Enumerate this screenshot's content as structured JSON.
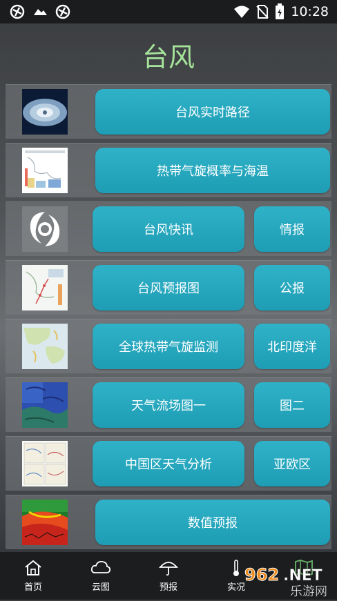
{
  "status_bar": {
    "time": "10:28",
    "icons_left": [
      "sync-icon",
      "cloud-icon",
      "sync-icon"
    ],
    "icons_right": [
      "wifi-icon",
      "no-sim-icon",
      "battery-icon"
    ]
  },
  "page_title": "台风",
  "rows": [
    {
      "thumb": "satellite-typhoon-thumbnail",
      "main_label": "台风实时路径",
      "side_label": null
    },
    {
      "thumb": "tropical-cyclone-map-thumbnail",
      "main_label": "热带气旋概率与海温",
      "side_label": null
    },
    {
      "thumb": "typhoon-symbol-thumbnail",
      "main_label": "台风快讯",
      "side_label": "情报"
    },
    {
      "thumb": "forecast-chart-thumbnail",
      "main_label": "台风预报图",
      "side_label": "公报"
    },
    {
      "thumb": "global-map-thumbnail",
      "main_label": "全球热带气旋监测",
      "side_label": "北印度洋"
    },
    {
      "thumb": "wind-field-thumbnail",
      "main_label": "天气流场图一",
      "side_label": "图二"
    },
    {
      "thumb": "weather-analysis-thumbnail",
      "main_label": "中国区天气分析",
      "side_label": "亚欧区"
    },
    {
      "thumb": "numeric-forecast-thumbnail",
      "main_label": "数值预报",
      "side_label": null
    }
  ],
  "bottom_nav": [
    {
      "label": "首页",
      "icon": "home-icon"
    },
    {
      "label": "云图",
      "icon": "cloud-icon"
    },
    {
      "label": "预报",
      "icon": "umbrella-icon"
    },
    {
      "label": "实况",
      "icon": "thermometer-icon"
    },
    {
      "label": "",
      "icon": "map-icon"
    }
  ],
  "watermark": {
    "text_top": "962.NET",
    "text_bottom": "乐游网"
  },
  "colors": {
    "accent": "#23a8be",
    "title_green": "#a5e39a",
    "status_bar": "#1b1c1e"
  }
}
